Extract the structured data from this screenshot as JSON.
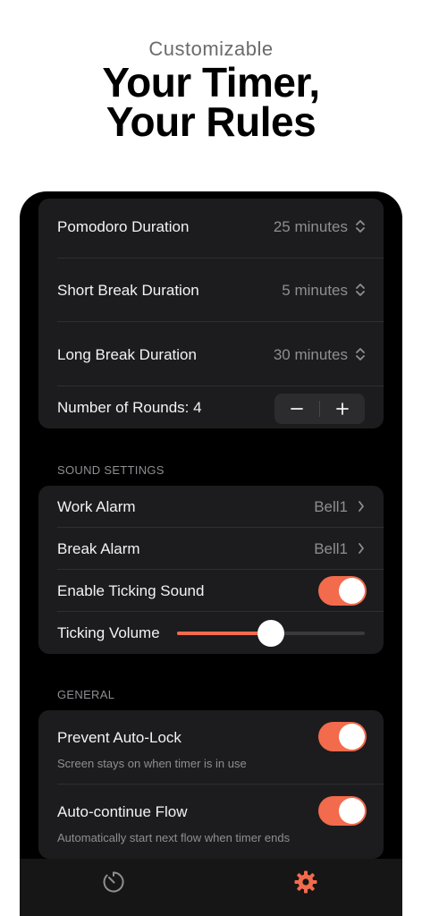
{
  "hero": {
    "subtitle": "Customizable",
    "title_line1": "Your Timer,",
    "title_line2": "Your Rules"
  },
  "durations": [
    {
      "label": "Pomodoro Duration",
      "value": "25 minutes"
    },
    {
      "label": "Short Break Duration",
      "value": "5 minutes"
    },
    {
      "label": "Long Break Duration",
      "value": "30 minutes"
    }
  ],
  "rounds": {
    "label": "Number of Rounds: 4",
    "minus": "−",
    "plus": "+"
  },
  "sound": {
    "header": "SOUND SETTINGS",
    "work_alarm": {
      "label": "Work Alarm",
      "value": "Bell1"
    },
    "break_alarm": {
      "label": "Break Alarm",
      "value": "Bell1"
    },
    "ticking": {
      "label": "Enable Ticking Sound",
      "on": true
    },
    "volume": {
      "label": "Ticking Volume",
      "level": 0.5
    }
  },
  "general": {
    "header": "GENERAL",
    "autolock": {
      "label": "Prevent Auto-Lock",
      "sub": "Screen stays on when timer is in use",
      "on": true
    },
    "autocontinue": {
      "label": "Auto-continue Flow",
      "sub": "Automatically start next flow when timer ends",
      "on": true
    }
  },
  "tabbar": {
    "tabs": [
      {
        "icon": "timer-icon",
        "active": false
      },
      {
        "icon": "gear-icon",
        "active": true
      }
    ]
  },
  "colors": {
    "accent": "#f26b4c",
    "inactive_tab": "#8e8e93",
    "card": "#1c1c1e"
  }
}
